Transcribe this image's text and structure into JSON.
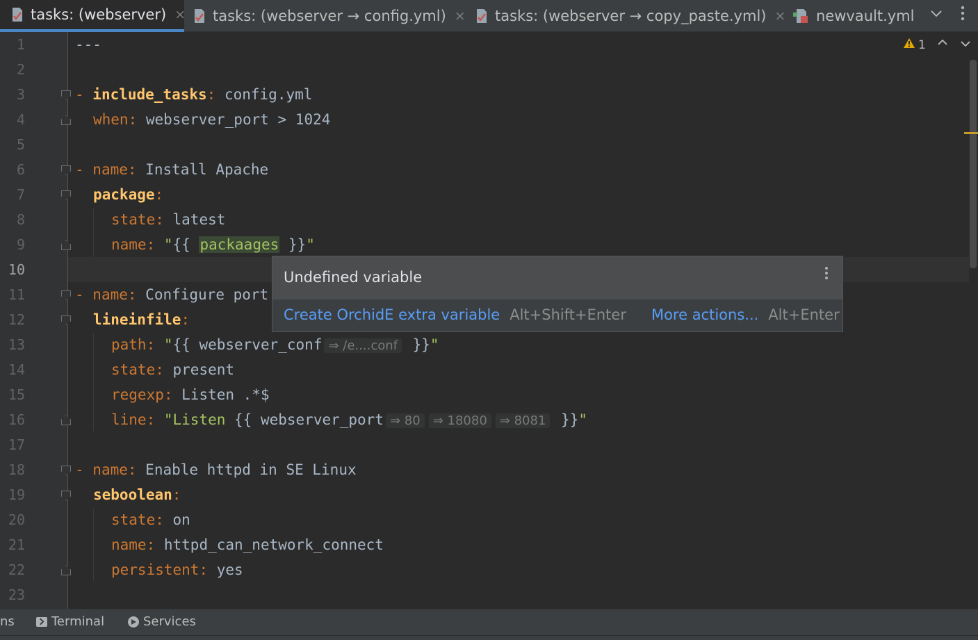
{
  "tabs": [
    {
      "label": "tasks: (webserver)",
      "active": true,
      "icon": "yaml-file-icon"
    },
    {
      "label": "tasks: (webserver → config.yml)",
      "active": false,
      "icon": "yaml-file-icon"
    },
    {
      "label": "tasks: (webserver → copy_paste.yml)",
      "active": false,
      "icon": "yaml-file-icon"
    },
    {
      "label": "newvault.yml",
      "active": false,
      "icon": "vault-file-icon"
    }
  ],
  "tab_close_glyph": "×",
  "tab_overflow_icon": "chevron-down-icon",
  "tab_more_icon": "more-vertical-icon",
  "line_numbers": [
    "1",
    "2",
    "3",
    "4",
    "5",
    "6",
    "7",
    "8",
    "9",
    "10",
    "11",
    "12",
    "13",
    "14",
    "15",
    "16",
    "17",
    "18",
    "19",
    "20",
    "21",
    "22",
    "23"
  ],
  "current_line": "10",
  "code": {
    "l1": "---",
    "l3_dash": "- ",
    "l3_key": "include_tasks",
    "l3_colon": ": ",
    "l3_val": "config.yml",
    "l4_key": "when",
    "l4_colon": ": ",
    "l4_val": "webserver_port > 1024",
    "l6_dash": "- ",
    "l6_key": "name",
    "l6_colon": ": ",
    "l6_val": "Install Apache",
    "l7_key": "package",
    "l7_colon": ":",
    "l8_key": "state",
    "l8_colon": ": ",
    "l8_val": "latest",
    "l9_key": "name",
    "l9_colon": ": ",
    "l9_q1": "\"",
    "l9_open": "{{ ",
    "l9_var": "packaages",
    "l9_close": " }}",
    "l9_q2": "\"",
    "l11_dash": "- ",
    "l11_key": "name",
    "l11_colon": ": ",
    "l11_val": "Configure port",
    "l12_key": "lineinfile",
    "l12_colon": ":",
    "l13_key": "path",
    "l13_colon": ": ",
    "l13_q1": "\"",
    "l13_open": "{{ ",
    "l13_var": "webserver_conf",
    "l13_hint": "⇒ /e....conf",
    "l13_close": " }}",
    "l13_q2": "\"",
    "l14_key": "state",
    "l14_colon": ": ",
    "l14_val": "present",
    "l15_key": "regexp",
    "l15_colon": ": ",
    "l15_val": "Listen .*$",
    "l16_key": "line",
    "l16_colon": ": ",
    "l16_q1": "\"Listen ",
    "l16_open": "{{ ",
    "l16_var": "webserver_port",
    "l16_hint1": "⇒ 80",
    "l16_hint2": "⇒ 18080",
    "l16_hint3": "⇒ 8081",
    "l16_close": " }}",
    "l16_q2": "\"",
    "l18_dash": "- ",
    "l18_key": "name",
    "l18_colon": ": ",
    "l18_val": "Enable httpd in SE Linux",
    "l19_key": "seboolean",
    "l19_colon": ":",
    "l20_key": "state",
    "l20_colon": ": ",
    "l20_val": "on",
    "l21_key": "name",
    "l21_colon": ": ",
    "l21_val": "httpd_can_network_connect",
    "l22_key": "persistent",
    "l22_colon": ": ",
    "l22_val": "yes"
  },
  "inspection": {
    "warning_icon": "warning-triangle-icon",
    "warning_count": "1"
  },
  "popup": {
    "title": "Undefined variable",
    "primary_action": "Create OrchidE extra variable",
    "primary_shortcut": "Alt+Shift+Enter",
    "secondary_action": "More actions...",
    "secondary_shortcut": "Alt+Enter"
  },
  "toolbar": {
    "partial_label": "ns",
    "terminal_label": "Terminal",
    "services_label": "Services"
  },
  "colors": {
    "keyword": "#cc7832",
    "bold_key": "#ffc66d",
    "string": "#a5c261",
    "link": "#589df6",
    "accent": "#4a88c7",
    "warning": "#e0a800"
  }
}
